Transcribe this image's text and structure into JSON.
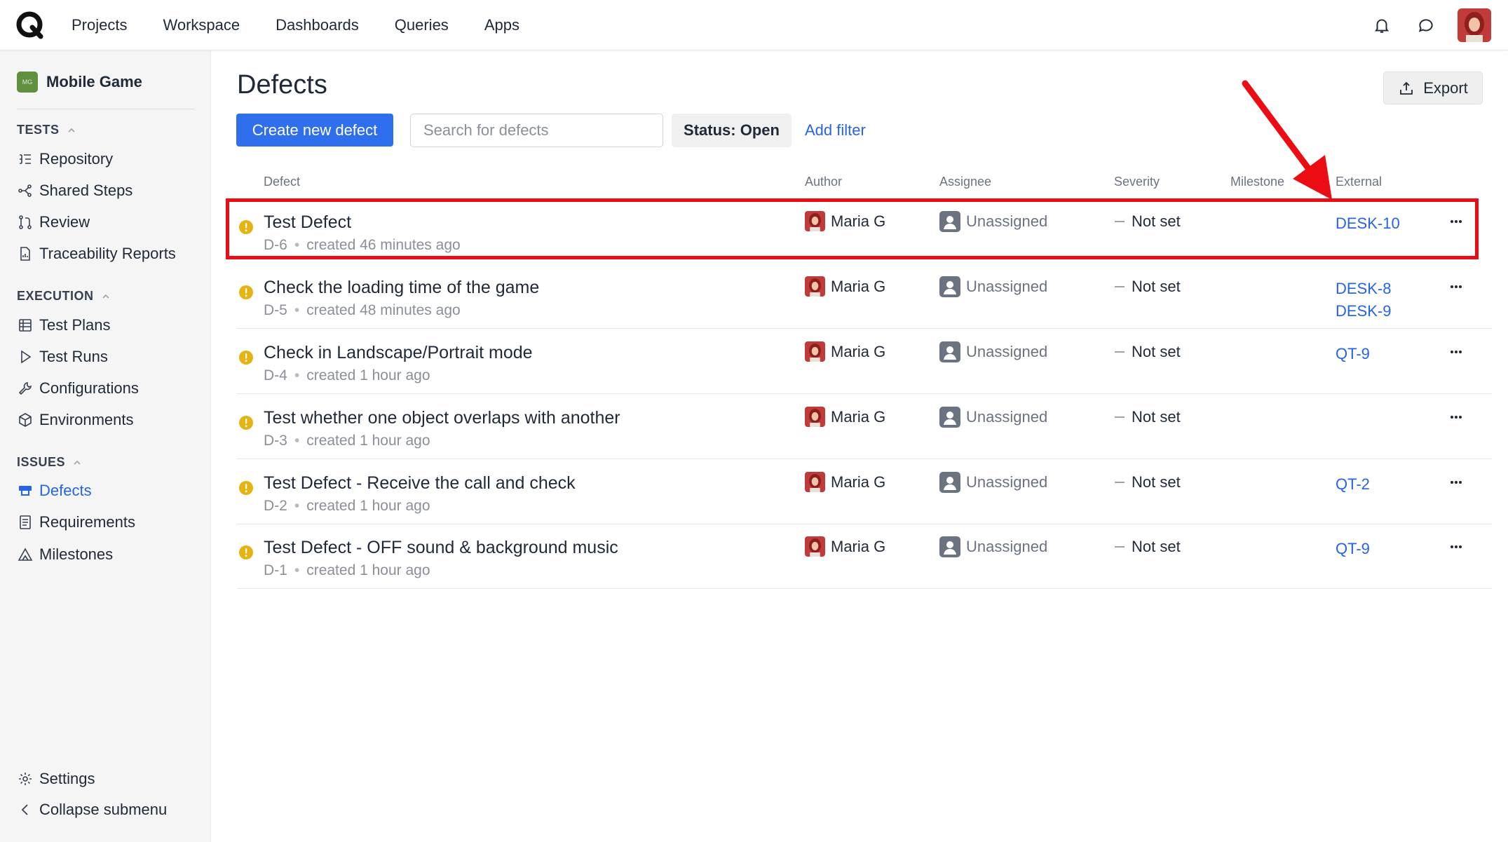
{
  "nav": {
    "logo": "Q",
    "items": [
      "Projects",
      "Workspace",
      "Dashboards",
      "Queries",
      "Apps"
    ],
    "icons": [
      "bell-icon",
      "chat-icon",
      "user-avatar"
    ]
  },
  "sidebar": {
    "project_badge": "MG",
    "project_name": "Mobile Game",
    "sections": {
      "tests": "TESTS",
      "execution": "EXECUTION",
      "issues": "ISSUES"
    },
    "items": {
      "repository": "Repository",
      "shared_steps": "Shared Steps",
      "review": "Review",
      "traceability": "Traceability Reports",
      "test_plans": "Test Plans",
      "test_runs": "Test Runs",
      "configurations": "Configurations",
      "environments": "Environments",
      "defects": "Defects",
      "requirements": "Requirements",
      "milestones": "Milestones",
      "settings": "Settings",
      "collapse": "Collapse submenu"
    }
  },
  "main": {
    "title": "Defects",
    "export_label": "Export",
    "create_label": "Create new defect",
    "search_placeholder": "Search for defects",
    "status_filter": "Status: Open",
    "add_filter": "Add filter",
    "columns": {
      "defect": "Defect",
      "author": "Author",
      "assignee": "Assignee",
      "severity": "Severity",
      "milestone": "Milestone",
      "external": "External"
    },
    "rows": [
      {
        "title": "Test Defect",
        "id": "D-6",
        "created": "created 46 minutes ago",
        "author": "Maria G",
        "assignee": "Unassigned",
        "severity": "Not set",
        "external": [
          "DESK-10"
        ]
      },
      {
        "title": "Check the loading time of the game",
        "id": "D-5",
        "created": "created 48 minutes ago",
        "author": "Maria G",
        "assignee": "Unassigned",
        "severity": "Not set",
        "external": [
          "DESK-8",
          "DESK-9"
        ]
      },
      {
        "title": "Check in Landscape/Portrait mode",
        "id": "D-4",
        "created": "created 1 hour ago",
        "author": "Maria G",
        "assignee": "Unassigned",
        "severity": "Not set",
        "external": [
          "QT-9"
        ]
      },
      {
        "title": "Test whether one object overlaps with another",
        "id": "D-3",
        "created": "created 1 hour ago",
        "author": "Maria G",
        "assignee": "Unassigned",
        "severity": "Not set",
        "external": []
      },
      {
        "title": "Test Defect - Receive the call and check",
        "id": "D-2",
        "created": "created 1 hour ago",
        "author": "Maria G",
        "assignee": "Unassigned",
        "severity": "Not set",
        "external": [
          "QT-2"
        ]
      },
      {
        "title": "Test Defect - OFF sound & background music",
        "id": "D-1",
        "created": "created 1 hour ago",
        "author": "Maria G",
        "assignee": "Unassigned",
        "severity": "Not set",
        "external": [
          "QT-9"
        ]
      }
    ]
  },
  "colors": {
    "accent": "#2f6fed",
    "link": "#2563eb",
    "status_open": "#e6b412",
    "annotation": "#ec0d14"
  }
}
